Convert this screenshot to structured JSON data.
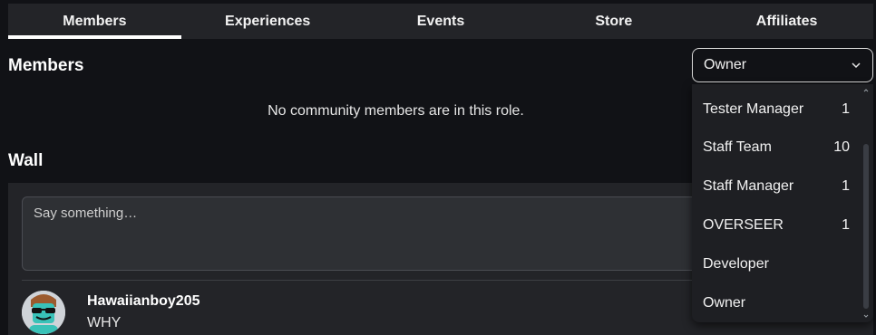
{
  "tabs": [
    {
      "label": "Members",
      "active": true
    },
    {
      "label": "Experiences",
      "active": false
    },
    {
      "label": "Events",
      "active": false
    },
    {
      "label": "Store",
      "active": false
    },
    {
      "label": "Affiliates",
      "active": false
    }
  ],
  "members": {
    "title": "Members",
    "empty_message": "No community members are in this role."
  },
  "role_select": {
    "selected": "Owner",
    "options": [
      {
        "label": "Tester Manager",
        "count": "1"
      },
      {
        "label": "Staff Team",
        "count": "10"
      },
      {
        "label": "Staff Manager",
        "count": "1"
      },
      {
        "label": "OVERSEER",
        "count": "1"
      },
      {
        "label": "Developer",
        "count": ""
      },
      {
        "label": "Owner",
        "count": ""
      }
    ]
  },
  "wall": {
    "title": "Wall",
    "placeholder": "Say something…",
    "post": {
      "username": "Hawaiianboy205",
      "text": "WHY"
    }
  },
  "colors": {
    "background": "#111216",
    "panel": "#232428",
    "accent": "#ffffff"
  }
}
